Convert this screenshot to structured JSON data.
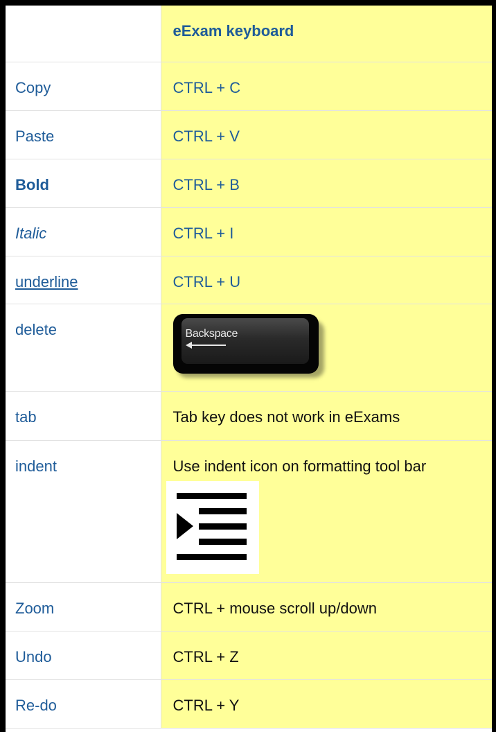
{
  "header": {
    "left": "",
    "right": "eExam keyboard"
  },
  "rows": [
    {
      "action": "Copy",
      "shortcut": "CTRL + C"
    },
    {
      "action": "Paste",
      "shortcut": "CTRL + V"
    },
    {
      "action": "Bold",
      "shortcut": "CTRL + B"
    },
    {
      "action": "Italic",
      "shortcut": "CTRL + I"
    },
    {
      "action": "underline",
      "shortcut": "CTRL + U"
    },
    {
      "action": "delete",
      "shortcut": "",
      "key_label": "Backspace",
      "key_icon": "backspace-key-icon"
    },
    {
      "action": "tab",
      "shortcut": "Tab key does not work in eExams"
    },
    {
      "action": "indent",
      "shortcut": "Use indent icon on formatting tool bar",
      "icon": "indent-icon"
    },
    {
      "action": "Zoom",
      "shortcut": "CTRL + mouse scroll up/down"
    },
    {
      "action": "Undo",
      "shortcut": "CTRL + Z"
    },
    {
      "action": "Re-do",
      "shortcut": "CTRL + Y"
    }
  ],
  "colors": {
    "left_text": "#1f5c99",
    "right_bg": "#ffff99",
    "border": "#000000"
  }
}
